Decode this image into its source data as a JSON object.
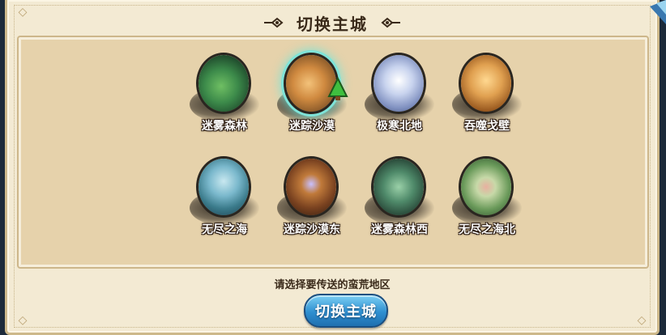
{
  "dialog": {
    "title": "切换主城",
    "hint": "请选择要传送的蛮荒地区",
    "confirm_label": "切换主城"
  },
  "cities": [
    {
      "name": "迷雾森林",
      "scene": "forest-mist-icon",
      "colors": [
        "#2f6b3a",
        "#6fbf63"
      ],
      "selected": false
    },
    {
      "name": "迷踪沙漠",
      "scene": "desert-icon",
      "colors": [
        "#8a5a2a",
        "#e0a050"
      ],
      "selected": true
    },
    {
      "name": "极寒北地",
      "scene": "frozen-north-icon",
      "colors": [
        "#6e7fa8",
        "#dfe6f5"
      ],
      "selected": false
    },
    {
      "name": "吞噬戈壁",
      "scene": "gobi-palace-icon",
      "colors": [
        "#8a5520",
        "#f2c070"
      ],
      "selected": false
    },
    {
      "name": "无尽之海",
      "scene": "endless-sea-icon",
      "colors": [
        "#2e5f7a",
        "#8fc8d8"
      ],
      "selected": false
    },
    {
      "name": "迷踪沙漠东",
      "scene": "desert-cave-icon",
      "colors": [
        "#4a2a18",
        "#b8723a"
      ],
      "selected": false
    },
    {
      "name": "迷雾森林西",
      "scene": "forest-ruins-icon",
      "colors": [
        "#2a4a3a",
        "#6fae8a"
      ],
      "selected": false
    },
    {
      "name": "无尽之海北",
      "scene": "sea-altar-icon",
      "colors": [
        "#4a7a4a",
        "#c7d9a8"
      ],
      "selected": false
    }
  ],
  "current_marker": "tree-marker-icon",
  "theme": {
    "accent": "#2e8fd0",
    "selection_glow": "#7fe3d8",
    "panel": "#e6d2ab"
  }
}
